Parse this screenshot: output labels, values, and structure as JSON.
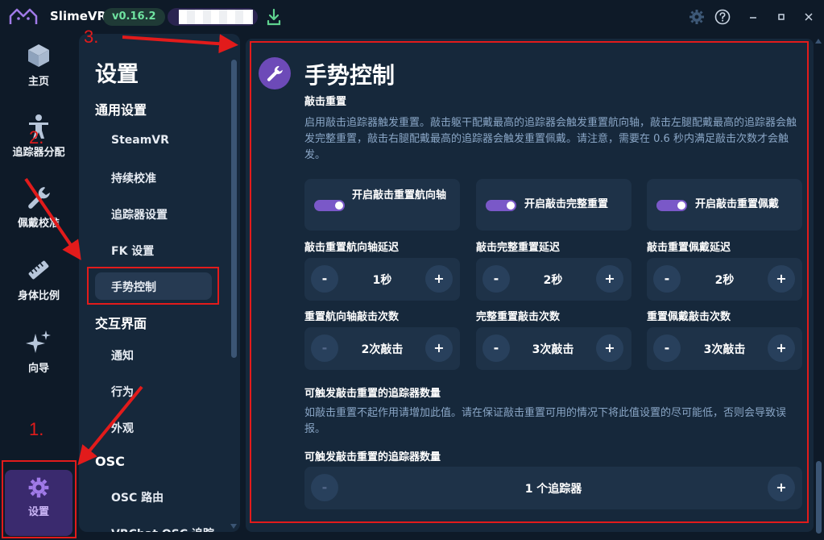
{
  "titlebar": {
    "app_name": "SlimeVR",
    "version": "v0.16.2"
  },
  "nav": {
    "home": "主页",
    "tracker_assign": "追踪器分配",
    "mounting": "佩戴校准",
    "proportions": "身体比例",
    "wizard": "向导",
    "settings": "设置"
  },
  "sidebar": {
    "title": "设置",
    "sections": {
      "general": "通用设置",
      "interface": "交互界面",
      "osc": "OSC"
    },
    "items": {
      "steamvr": "SteamVR",
      "drift": "持续校准",
      "trackers": "追踪器设置",
      "fk": "FK 设置",
      "gesture": "手势控制",
      "notify": "通知",
      "behavior": "行为",
      "appearance": "外观",
      "osc_router": "OSC 路由",
      "vrchat_osc": "VRChat OSC 追踪"
    }
  },
  "main": {
    "title": "手势控制",
    "tap_title": "敲击重置",
    "tap_desc": "启用敲击追踪器触发重置。敲击躯干配戴最高的追踪器会触发重置航向轴，敲击左腿配戴最高的追踪器会触发完整重置，敲击右腿配戴最高的追踪器会触发重置佩戴。请注意，需要在 0.6 秒内满足敲击次数才会触发。",
    "toggles": [
      "开启敲击重置航向轴",
      "开启敲击完整重置",
      "开启敲击重置佩戴"
    ],
    "delay_labels": [
      "敲击重置航向轴延迟",
      "敲击完整重置延迟",
      "敲击重置佩戴延迟"
    ],
    "delay_values": [
      "1秒",
      "2秒",
      "2秒"
    ],
    "count_labels": [
      "重置航向轴敲击次数",
      "完整重置敲击次数",
      "重置佩戴敲击次数"
    ],
    "count_values": [
      "2次敲击",
      "3次敲击",
      "3次敲击"
    ],
    "trackers_title": "可触发敲击重置的追踪器数量",
    "trackers_desc": "如敲击重置不起作用请增加此值。请在保证敲击重置可用的情况下将此值设置的尽可能低，否则会导致误报。",
    "trackers_label": "可触发敲击重置的追踪器数量",
    "trackers_value": "1 个追踪器",
    "minus": "-",
    "plus": "+"
  },
  "annotations": {
    "n1": "1.",
    "n2": "2.",
    "n3": "3."
  },
  "colors": {
    "accent": "#7a58c8",
    "version_text": "#6fe3a0",
    "annotation": "#e21b1b"
  }
}
